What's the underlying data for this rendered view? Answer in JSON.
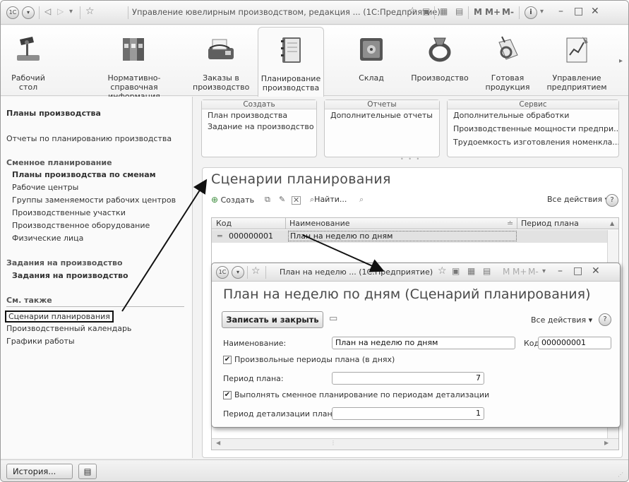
{
  "window": {
    "title": "Управление ювелирным производством, редакция ... (1С:Предприятие)",
    "toolbar_marks": [
      "M",
      "M+",
      "M-"
    ]
  },
  "sections": [
    {
      "label": "Рабочий стол",
      "icon": "desk-lamp-icon"
    },
    {
      "label": "Нормативно-справочная информация",
      "icon": "binders-icon"
    },
    {
      "label": "Заказы в производство",
      "icon": "fax-machine-icon"
    },
    {
      "label": "Планирование производства",
      "icon": "planner-book-icon"
    },
    {
      "label": "Склад",
      "icon": "safe-icon"
    },
    {
      "label": "Производство",
      "icon": "ring-icon"
    },
    {
      "label": "Готовая продукция",
      "icon": "tag-ring-icon"
    },
    {
      "label": "Управление предприятием",
      "icon": "chart-icon"
    }
  ],
  "nav": {
    "plans": "Планы производства",
    "reports": "Отчеты по планированию производства",
    "shift_group": "Сменное планирование",
    "shift_plans": "Планы производства по сменам",
    "work_centers": "Рабочие центры",
    "interchange_groups": "Группы заменяемости рабочих центров",
    "prod_sections": "Производственные участки",
    "equipment": "Производственное оборудование",
    "persons": "Физические лица",
    "tasks_group": "Задания на производство",
    "tasks": "Задания на производство",
    "see_also": "См. также",
    "scenarios": "Сценарии планирования",
    "calendar": "Производственный календарь",
    "schedules": "Графики работы"
  },
  "command_panel": {
    "create": {
      "header": "Создать",
      "items": [
        "План производства",
        "Задание на производство"
      ]
    },
    "reports": {
      "header": "Отчеты",
      "items": [
        "Дополнительные отчеты"
      ]
    },
    "service": {
      "header": "Сервис",
      "items": [
        "Дополнительные обработки",
        "Производственные мощности предпри...",
        "Трудоемкость изготовления номенкла..."
      ]
    }
  },
  "list_form": {
    "title": "Сценарии планирования",
    "create_label": "Создать",
    "find_label": "Найти...",
    "all_actions": "Все действия",
    "help": "?",
    "columns": {
      "code": "Код",
      "name": "Наименование",
      "period": "Период плана"
    },
    "row": {
      "code": "000000001",
      "name": "План на неделю по дням",
      "period": ""
    }
  },
  "dialog": {
    "title": "План на неделю ...  (1С:Предприятие)",
    "marks": [
      "M",
      "M+",
      "M-"
    ],
    "heading": "План на неделю по дням (Сценарий планирования)",
    "save_close": "Записать и закрыть",
    "all_actions": "Все действия",
    "help": "?",
    "name_label": "Наименование:",
    "name_value": "План на неделю по дням",
    "code_label": "Код:",
    "code_value": "000000001",
    "arbitrary_periods_label": "Произвольные периоды плана (в днях)",
    "arbitrary_periods_checked": true,
    "plan_period_label": "Период плана:",
    "plan_period_value": "7",
    "shift_planning_label": "Выполнять сменное планирование по периодам детализации",
    "shift_planning_checked": true,
    "detail_period_label": "Период детализации плана:",
    "detail_period_value": "1"
  },
  "status": {
    "history": "История..."
  }
}
